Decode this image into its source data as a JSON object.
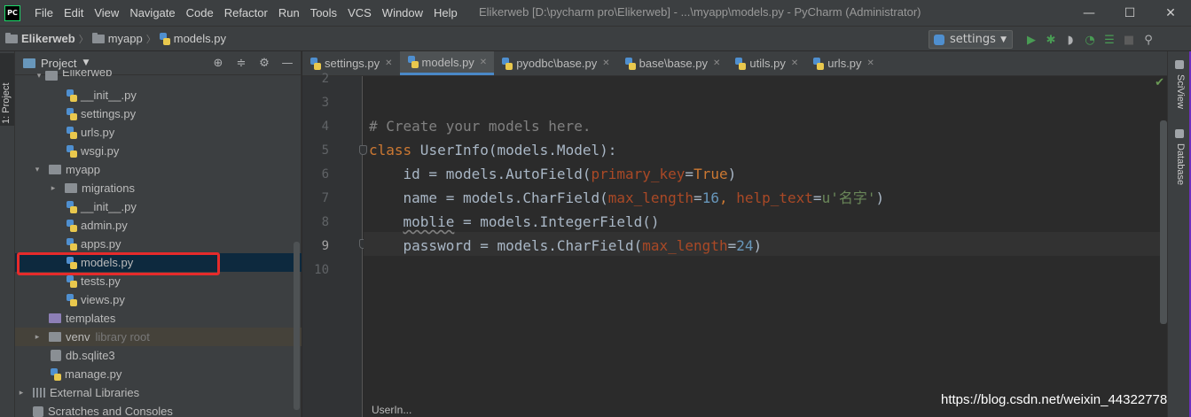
{
  "app": {
    "logo_text": "PC",
    "window_title": "Elikerweb [D:\\pycharm pro\\Elikerweb] - ...\\myapp\\models.py - PyCharm (Administrator)"
  },
  "menu": [
    {
      "label": "File"
    },
    {
      "label": "Edit"
    },
    {
      "label": "View"
    },
    {
      "label": "Navigate"
    },
    {
      "label": "Code"
    },
    {
      "label": "Refactor"
    },
    {
      "label": "Run"
    },
    {
      "label": "Tools"
    },
    {
      "label": "VCS"
    },
    {
      "label": "Window"
    },
    {
      "label": "Help"
    }
  ],
  "window_controls": {
    "minimize": "—",
    "maximize": "☐",
    "close": "✕"
  },
  "breadcrumb": {
    "project": "Elikerweb",
    "folder": "myapp",
    "file": "models.py"
  },
  "run_config": {
    "label": "settings"
  },
  "project_panel": {
    "title": "Project",
    "tree": [
      {
        "label": "Elikerweb",
        "type": "dir",
        "arrow": "▾",
        "partial": true
      },
      {
        "label": "__init__.py",
        "type": "py"
      },
      {
        "label": "settings.py",
        "type": "py"
      },
      {
        "label": "urls.py",
        "type": "py"
      },
      {
        "label": "wsgi.py",
        "type": "py"
      },
      {
        "label": "myapp",
        "type": "dir",
        "arrow": "▾"
      },
      {
        "label": "migrations",
        "type": "dir",
        "arrow": "▸"
      },
      {
        "label": "__init__.py",
        "type": "py"
      },
      {
        "label": "admin.py",
        "type": "py"
      },
      {
        "label": "apps.py",
        "type": "py"
      },
      {
        "label": "models.py",
        "type": "py",
        "selected": true
      },
      {
        "label": "tests.py",
        "type": "py"
      },
      {
        "label": "views.py",
        "type": "py"
      },
      {
        "label": "templates",
        "type": "tpl"
      },
      {
        "label": "venv",
        "type": "dir",
        "arrow": "▸",
        "suffix": "library root"
      },
      {
        "label": "db.sqlite3",
        "type": "db"
      },
      {
        "label": "manage.py",
        "type": "py"
      },
      {
        "label": "External Libraries",
        "type": "lib",
        "arrow": "▸"
      },
      {
        "label": "Scratches and Consoles",
        "type": "scr"
      }
    ]
  },
  "left_strip": {
    "label": "1: Project"
  },
  "editor_tabs": [
    {
      "label": "settings.py",
      "active": false
    },
    {
      "label": "models.py",
      "active": true
    },
    {
      "label": "pyodbc\\base.py",
      "active": false
    },
    {
      "label": "base\\base.py",
      "active": false
    },
    {
      "label": "utils.py",
      "active": false
    },
    {
      "label": "urls.py",
      "active": false
    }
  ],
  "editor": {
    "line_numbers": [
      "2",
      "3",
      "4",
      "5",
      "6",
      "7",
      "8",
      "9",
      "10"
    ],
    "current_line": "9",
    "code": {
      "l4_comment": "# Create your models here.",
      "l5_kw": "class",
      "l5_rest": " UserInfo(models.Model):",
      "l6_a": "    id = models.AutoField(",
      "l6_param": "primary_key",
      "l6_eq": "=",
      "l6_val": "True",
      "l6_end": ")",
      "l7_a": "    name = models.CharField(",
      "l7_p1": "max_length",
      "l7_eq1": "=",
      "l7_n1": "16",
      "l7_comma": ", ",
      "l7_p2": "help_text",
      "l7_eq2": "=",
      "l7_s": "u'名字'",
      "l7_end": ")",
      "l8_a": "    ",
      "l8_w": "moblie",
      "l8_b": " = models.IntegerField()",
      "l9_a": "    password = models.CharField(",
      "l9_p": "max_length",
      "l9_eq": "=",
      "l9_n": "24",
      "l9_end": ")"
    },
    "bottom_breadcrumb": "UserIn..."
  },
  "right_strip": {
    "sciview": "SciView",
    "database": "Database"
  },
  "watermark": "https://blog.csdn.net/weixin_44322778",
  "colors": {
    "accent": "#4a88c7",
    "highlight_box": "#e52b2b",
    "keyword": "#cc7832",
    "param": "#aa4926",
    "number": "#6897bb"
  }
}
